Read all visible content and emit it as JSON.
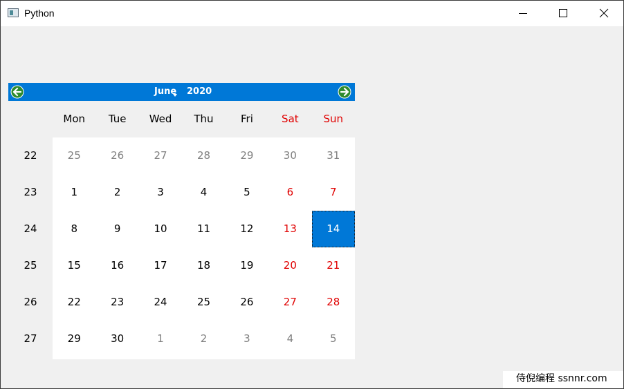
{
  "window": {
    "title": "Python"
  },
  "calendar": {
    "month": "June",
    "year": "2020",
    "day_names": [
      "Mon",
      "Tue",
      "Wed",
      "Thu",
      "Fri",
      "Sat",
      "Sun"
    ],
    "weeks": [
      {
        "number": "22",
        "days": [
          {
            "label": "25",
            "type": "other"
          },
          {
            "label": "26",
            "type": "other"
          },
          {
            "label": "27",
            "type": "other"
          },
          {
            "label": "28",
            "type": "other"
          },
          {
            "label": "29",
            "type": "other"
          },
          {
            "label": "30",
            "type": "other"
          },
          {
            "label": "31",
            "type": "other"
          }
        ]
      },
      {
        "number": "23",
        "days": [
          {
            "label": "1",
            "type": "current"
          },
          {
            "label": "2",
            "type": "current"
          },
          {
            "label": "3",
            "type": "current"
          },
          {
            "label": "4",
            "type": "current"
          },
          {
            "label": "5",
            "type": "current"
          },
          {
            "label": "6",
            "type": "current"
          },
          {
            "label": "7",
            "type": "current"
          }
        ]
      },
      {
        "number": "24",
        "days": [
          {
            "label": "8",
            "type": "current"
          },
          {
            "label": "9",
            "type": "current"
          },
          {
            "label": "10",
            "type": "current"
          },
          {
            "label": "11",
            "type": "current"
          },
          {
            "label": "12",
            "type": "current"
          },
          {
            "label": "13",
            "type": "current"
          },
          {
            "label": "14",
            "type": "current",
            "selected": true
          }
        ]
      },
      {
        "number": "25",
        "days": [
          {
            "label": "15",
            "type": "current"
          },
          {
            "label": "16",
            "type": "current"
          },
          {
            "label": "17",
            "type": "current"
          },
          {
            "label": "18",
            "type": "current"
          },
          {
            "label": "19",
            "type": "current"
          },
          {
            "label": "20",
            "type": "current"
          },
          {
            "label": "21",
            "type": "current"
          }
        ]
      },
      {
        "number": "26",
        "days": [
          {
            "label": "22",
            "type": "current"
          },
          {
            "label": "23",
            "type": "current"
          },
          {
            "label": "24",
            "type": "current"
          },
          {
            "label": "25",
            "type": "current"
          },
          {
            "label": "26",
            "type": "current"
          },
          {
            "label": "27",
            "type": "current"
          },
          {
            "label": "28",
            "type": "current"
          }
        ]
      },
      {
        "number": "27",
        "days": [
          {
            "label": "29",
            "type": "current"
          },
          {
            "label": "30",
            "type": "current"
          },
          {
            "label": "1",
            "type": "other"
          },
          {
            "label": "2",
            "type": "other"
          },
          {
            "label": "3",
            "type": "other"
          },
          {
            "label": "4",
            "type": "other"
          },
          {
            "label": "5",
            "type": "other"
          }
        ]
      }
    ]
  },
  "watermark": {
    "text": "侍倪编程 ssnnr.com"
  },
  "colors": {
    "accent": "#0078d7",
    "weekend": "#e00000",
    "other_month": "#808080",
    "nav_arrow": "#2e8b2e"
  },
  "icons": {
    "app": "app-window-icon",
    "minimize": "minimize-icon",
    "maximize": "maximize-icon",
    "close": "close-icon",
    "prev": "left-arrow-circle-icon",
    "next": "right-arrow-circle-icon"
  }
}
